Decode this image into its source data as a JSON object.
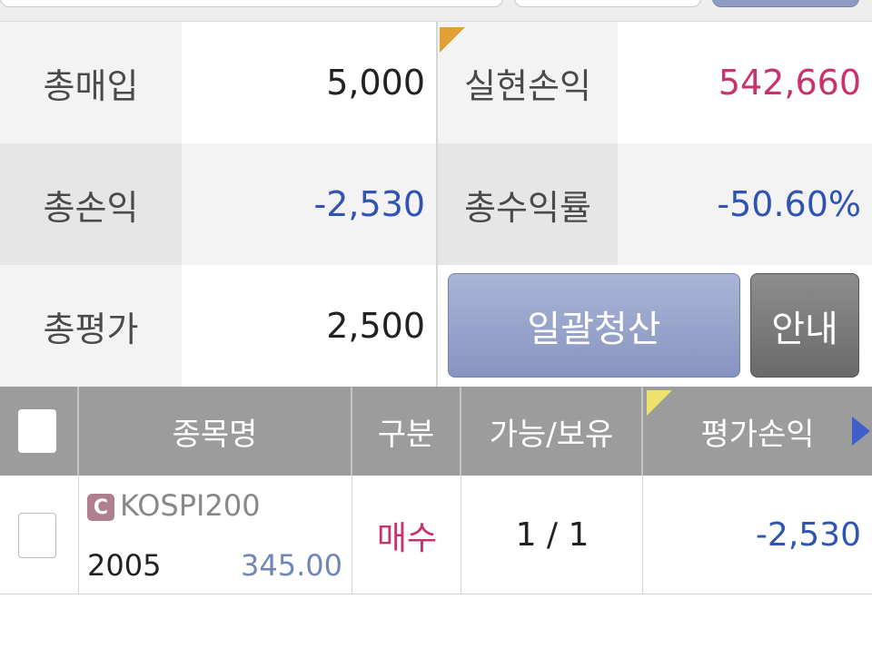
{
  "summary": {
    "total_buy_label": "총매입",
    "total_buy_value": "5,000",
    "realized_pl_label": "실현손익",
    "realized_pl_value": "542,660",
    "total_pl_label": "총손익",
    "total_pl_value": "-2,530",
    "total_return_label": "총수익률",
    "total_return_value": "-50.60%",
    "total_eval_label": "총평가",
    "total_eval_value": "2,500"
  },
  "buttons": {
    "liquidate_all": "일괄청산",
    "info": "안내"
  },
  "table": {
    "headers": [
      "종목명",
      "구분",
      "가능/보유",
      "평가손익"
    ],
    "rows": [
      {
        "badge": "C",
        "name": "KOSPI200",
        "code": "2005",
        "strike": "345.00",
        "side": "매수",
        "qty": "1 / 1",
        "pl": "-2,530"
      }
    ]
  },
  "colors": {
    "positive": "#c8326e",
    "negative": "#2f54b3",
    "accent_button": "#8e9cc4"
  },
  "icons": [
    "checkbox-icon",
    "scroll-right-arrow-icon",
    "call-option-badge-icon"
  ]
}
